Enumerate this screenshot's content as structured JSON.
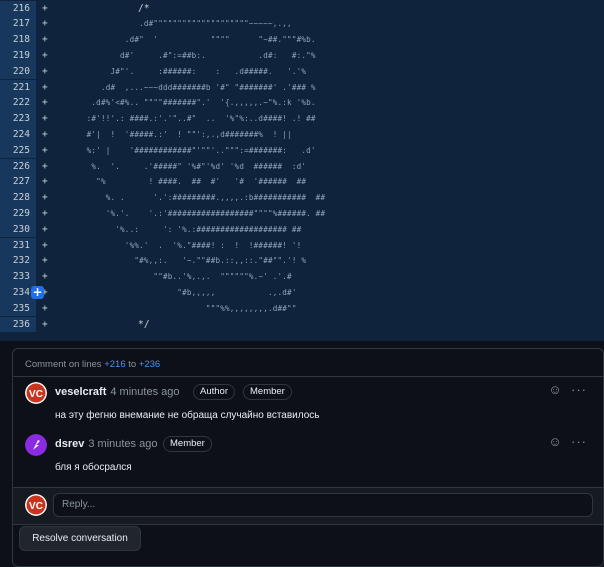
{
  "diff": {
    "lines": [
      {
        "num": "216",
        "sign": "+",
        "text": "/*",
        "is_comment": true
      },
      {
        "num": "217",
        "sign": "+",
        "text": "                 .d#\"\"\"\"\"\"\"\"\"\"\"\"\"\"\"\"\"\"\"\"~~~~~,.,,",
        "is_comment": false
      },
      {
        "num": "218",
        "sign": "+",
        "text": "              .d#\"  '           \"\"\"\"      \"~##.\"\"\"#%b.",
        "is_comment": false
      },
      {
        "num": "219",
        "sign": "+",
        "text": "             d#'     .#\":=##b:.           .d#:   #:.\"%",
        "is_comment": false
      },
      {
        "num": "220",
        "sign": "+",
        "text": "           J#\"'.     :######:    :   .d#####.   '.'%",
        "is_comment": false
      },
      {
        "num": "221",
        "sign": "+",
        "text": "         .d#  ,...~~~ddd#######b '#\" \"#######' .'### %",
        "is_comment": false
      },
      {
        "num": "222",
        "sign": "+",
        "text": "       .d#%'<#%.. \"\"\"\"#######\".'  '{.,,,,,.~\"%.:k '%b.",
        "is_comment": false
      },
      {
        "num": "223",
        "sign": "+",
        "text": "      :#'!!'.: ####.:'.'\"..#\"  ..  '%\"%:..d####! .! ##",
        "is_comment": false
      },
      {
        "num": "224",
        "sign": "+",
        "text": "      #'|  !  '#####.:'  ! \"\"':,.,d#######%  ! ||",
        "is_comment": false
      },
      {
        "num": "225",
        "sign": "+",
        "text": "      %:' |    '############\"'\"\"'..\"\"\":=#######:   .d'",
        "is_comment": false
      },
      {
        "num": "226",
        "sign": "+",
        "text": "       %.  '.     .'#####\" '%#\"'%d' '%d  ######  :d'",
        "is_comment": false
      },
      {
        "num": "227",
        "sign": "+",
        "text": "        \"%         ! ####.  ##  #'   '#  '######  ##",
        "is_comment": false
      },
      {
        "num": "228",
        "sign": "+",
        "text": "          %. .      '.':#########.,,,,.:b###########  ##",
        "is_comment": false
      },
      {
        "num": "229",
        "sign": "+",
        "text": "          '%.'.    '.:'##################\"\"\"\"%######. ##",
        "is_comment": false
      },
      {
        "num": "230",
        "sign": "+",
        "text": "            '%..:     ': '%.:################### ##",
        "is_comment": false
      },
      {
        "num": "231",
        "sign": "+",
        "text": "              '%%.'  .  '%.\"####! :  !  !######! '!",
        "is_comment": false
      },
      {
        "num": "232",
        "sign": "+",
        "text": "                \"#%,,:.   '~.\"\"##b.::,,::.\"##\"\".'! %",
        "is_comment": false
      },
      {
        "num": "233",
        "sign": "+",
        "text": "                    \"\"#b..'%,.,.  \"\"\"\"\"\"%.~' .'.#",
        "is_comment": false
      },
      {
        "num": "234",
        "sign": "+",
        "text": "                         \"#b,,,,,           .,.d#'",
        "is_comment": false
      },
      {
        "num": "235",
        "sign": "+",
        "text": "                               \"\"\"%%,,,,,,,,.d##\"\"",
        "is_comment": false
      },
      {
        "num": "236",
        "sign": "+",
        "text": "*/",
        "is_comment": true
      }
    ]
  },
  "thread": {
    "header_prefix": "Comment on lines ",
    "range_start": "+216",
    "range_sep": " to ",
    "range_end": "+236",
    "comments": [
      {
        "author": "veselcraft",
        "time": "4 minutes ago",
        "badges": [
          "Author",
          "Member"
        ],
        "body": "на эту фегню внемание не обраща случайно вставилось"
      },
      {
        "author": "dsrev",
        "time": "3 minutes ago",
        "badges": [
          "Member"
        ],
        "body": "бля я обосрался"
      }
    ],
    "reply_placeholder": "Reply...",
    "resolve_label": "Resolve conversation",
    "icons": {
      "emoji": "smiley-icon",
      "more": "kebab-icon"
    }
  },
  "colors": {
    "accent": "#4493f8",
    "diff_bg": "#0f233d",
    "gutter_bg": "#18375c",
    "avatar_vc": "#c9341f",
    "avatar_ds": "#8a2be2"
  }
}
